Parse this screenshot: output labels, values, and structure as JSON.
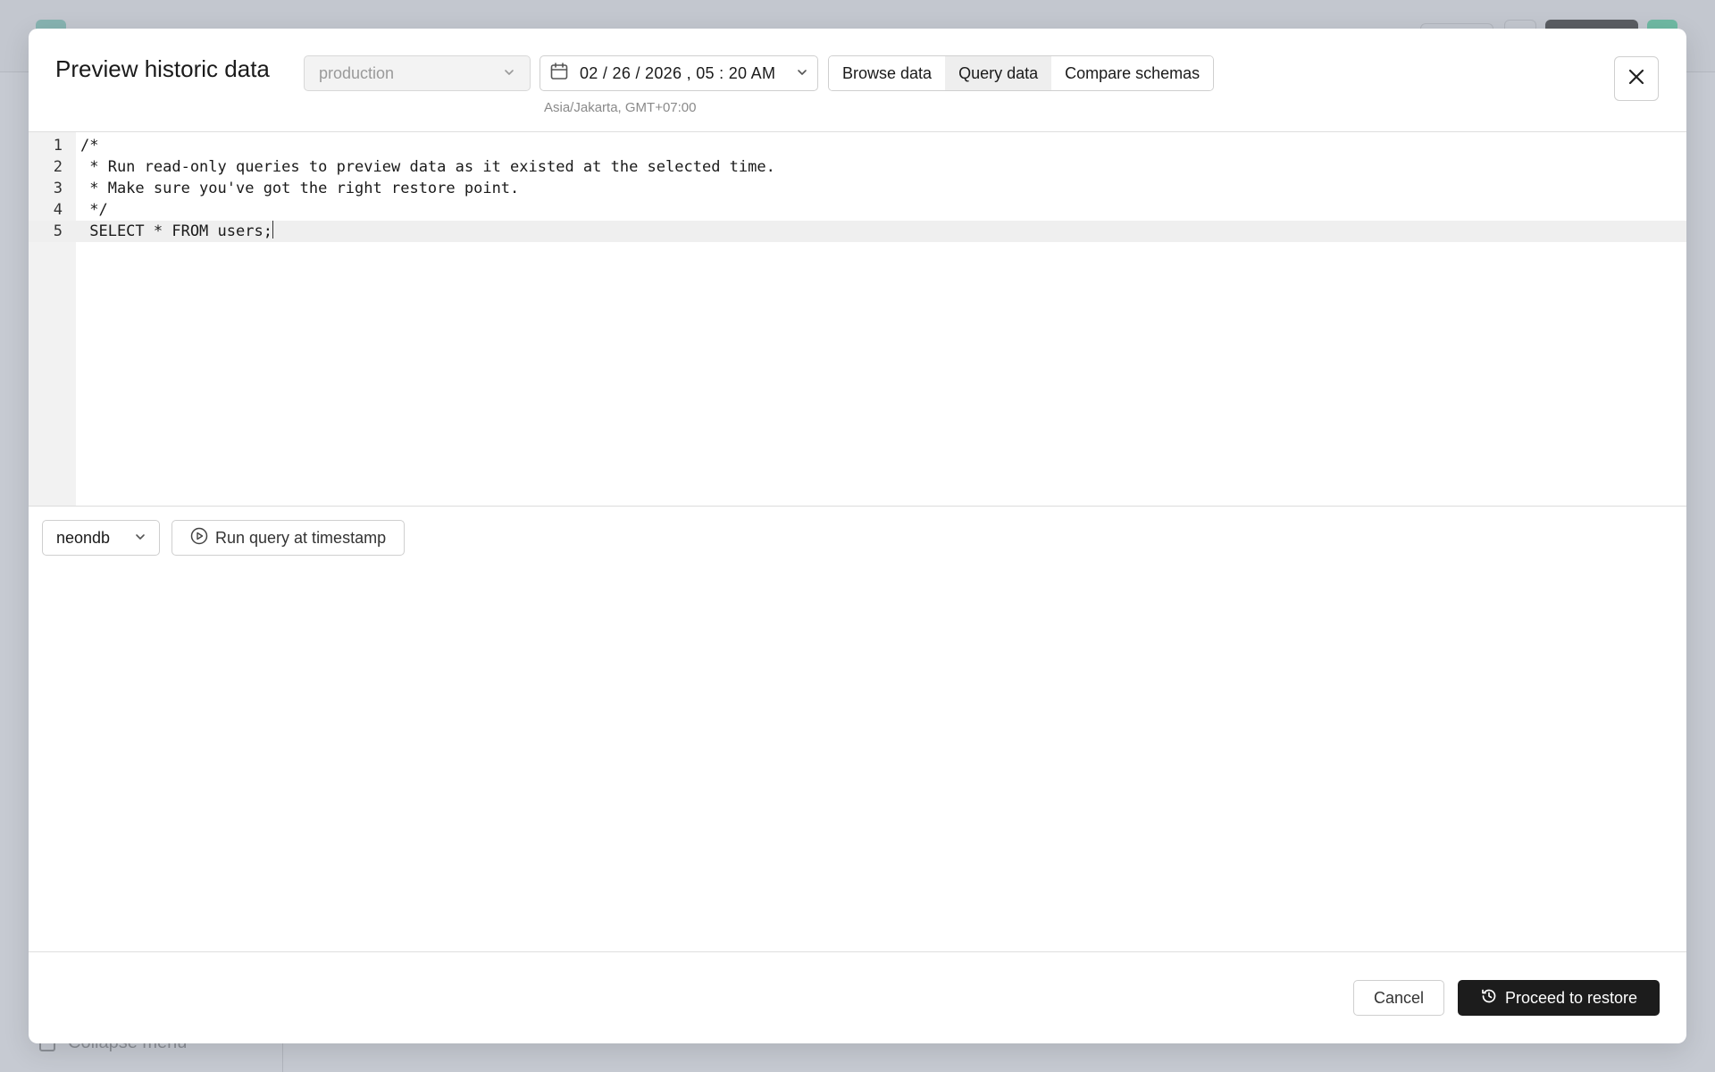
{
  "dialog": {
    "title": "Preview historic data",
    "branch_select": {
      "value": "production",
      "icon": "chevron-down-icon"
    },
    "datetime": {
      "value": "02 / 26 / 2026 ,  05 : 20   AM",
      "icon": "calendar-icon"
    },
    "timezone": "Asia/Jakarta, GMT+07:00",
    "tabs": [
      {
        "label": "Browse data",
        "active": false
      },
      {
        "label": "Query data",
        "active": true
      },
      {
        "label": "Compare schemas",
        "active": false
      }
    ],
    "close_icon": "close-icon"
  },
  "editor": {
    "lines": [
      {
        "number": "1",
        "text": "/*"
      },
      {
        "number": "2",
        "text": " * Run read-only queries to preview data as it existed at the selected time."
      },
      {
        "number": "3",
        "text": " * Make sure you've got the right restore point."
      },
      {
        "number": "4",
        "text": " */"
      },
      {
        "number": "5",
        "text": " SELECT * FROM users;"
      }
    ],
    "current_line": 5
  },
  "controls": {
    "database_select": {
      "value": "neondb"
    },
    "run_button": {
      "label": "Run query at timestamp",
      "icon": "play-circle-icon"
    }
  },
  "footer": {
    "cancel_label": "Cancel",
    "proceed_label": "Proceed to restore",
    "proceed_icon": "history-icon"
  },
  "background": {
    "collapse_label": "Collapse menu"
  },
  "colors": {
    "overlay": "#c6cad2",
    "primary_button": "#1c1c1c",
    "active_tab": "#eeeeee"
  }
}
